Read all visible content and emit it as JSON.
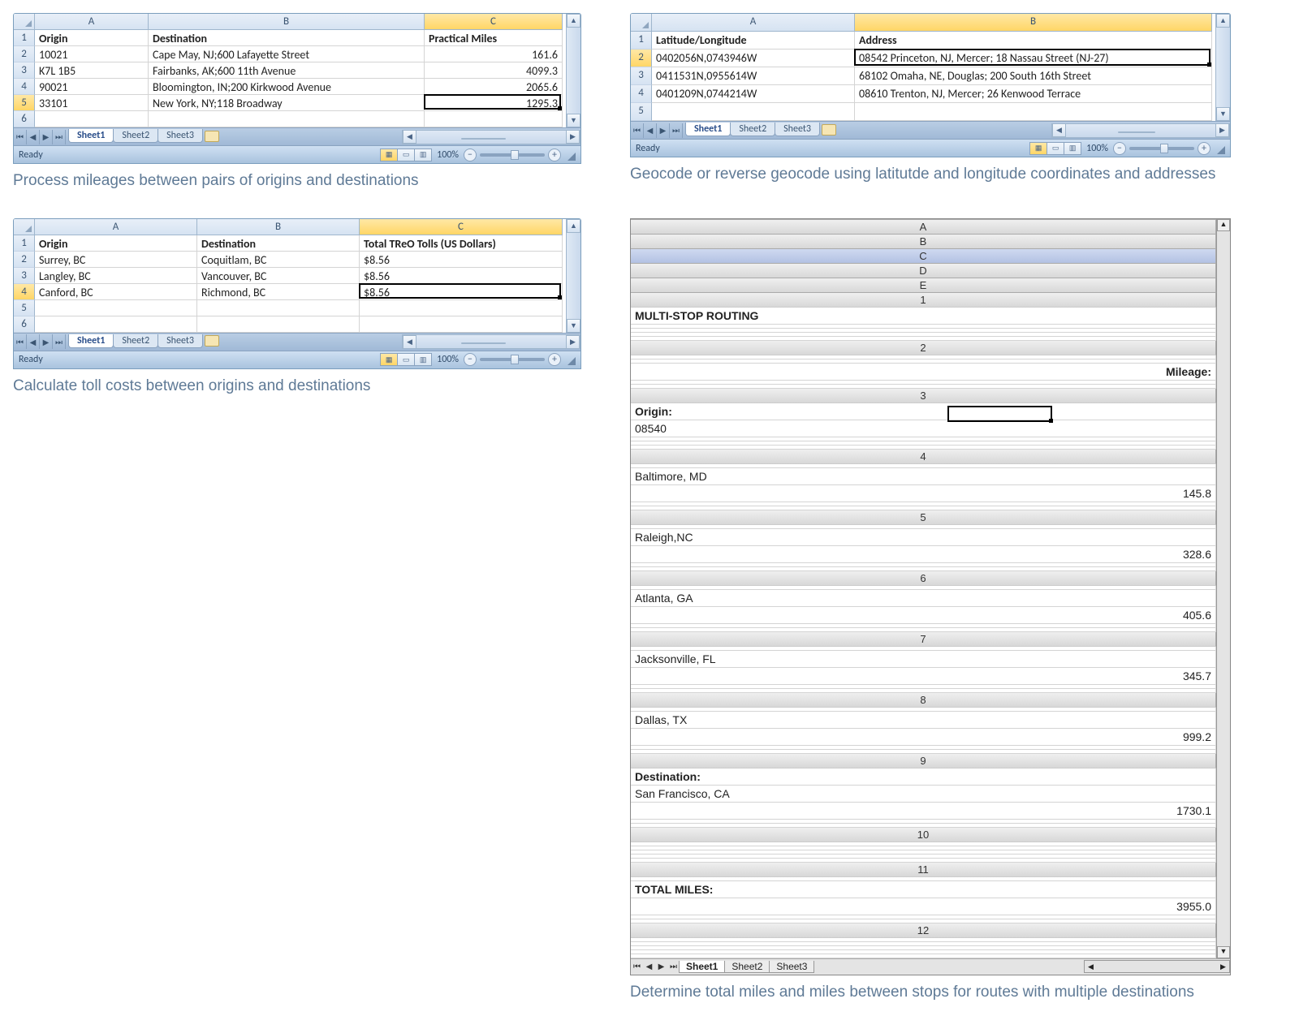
{
  "panes": {
    "p1": {
      "cols": [
        "A",
        "B",
        "C"
      ],
      "selected_col_index": 2,
      "selected_row_index": 4,
      "sel_cell_label": "C5",
      "rows": [
        {
          "n": "1",
          "cells": [
            "Origin",
            "Destination",
            "Practical Miles"
          ],
          "bold": true,
          "right2": false
        },
        {
          "n": "2",
          "cells": [
            "10021",
            "Cape May, NJ;600 Lafayette Street",
            "161.6"
          ],
          "right2": true
        },
        {
          "n": "3",
          "cells": [
            "K7L 1B5",
            "Fairbanks, AK;600 11th Avenue",
            "4099.3"
          ],
          "right2": true
        },
        {
          "n": "4",
          "cells": [
            "90021",
            "Bloomington, IN;200 Kirkwood Avenue",
            "2065.6"
          ],
          "right2": true
        },
        {
          "n": "5",
          "cells": [
            "33101",
            "New York, NY;118 Broadway",
            "1295.3"
          ],
          "right2": true
        },
        {
          "n": "6",
          "cells": [
            "",
            "",
            ""
          ],
          "right2": false
        }
      ],
      "tabs": [
        "Sheet1",
        "Sheet2",
        "Sheet3"
      ],
      "active_tab": 0,
      "status": "Ready",
      "zoom": "100%",
      "caption": "Process mileages between pairs of origins and destinations"
    },
    "p2": {
      "cols": [
        "A",
        "B"
      ],
      "selected_col_index": 1,
      "selected_row_index": 1,
      "sel_cell_label": "B2",
      "rows": [
        {
          "n": "1",
          "cells": [
            "Latitude/Longitude",
            "Address"
          ],
          "bold": true
        },
        {
          "n": "2",
          "cells": [
            "0402056N,0743946W",
            "08542 Princeton, NJ, Mercer; 18 Nassau Street  (NJ-27)"
          ]
        },
        {
          "n": "3",
          "cells": [
            "0411531N,0955614W",
            "68102 Omaha, NE, Douglas; 200 South 16th Street"
          ]
        },
        {
          "n": "4",
          "cells": [
            "0401209N,0744214W",
            "08610 Trenton, NJ, Mercer; 26 Kenwood Terrace"
          ]
        },
        {
          "n": "5",
          "cells": [
            "",
            ""
          ]
        }
      ],
      "tabs": [
        "Sheet1",
        "Sheet2",
        "Sheet3"
      ],
      "active_tab": 0,
      "status": "Ready",
      "zoom": "100%",
      "caption": "Geocode or reverse geocode using latitutde and longitude coordinates and addresses"
    },
    "p3": {
      "cols": [
        "A",
        "B",
        "C"
      ],
      "selected_col_index": 2,
      "selected_row_index": 3,
      "sel_cell_label": "C4",
      "rows": [
        {
          "n": "1",
          "cells": [
            "Origin",
            "Destination",
            "Total TReO Tolls (US Dollars)"
          ],
          "bold": true
        },
        {
          "n": "2",
          "cells": [
            "Surrey, BC",
            "Coquitlam, BC",
            "$8.56"
          ]
        },
        {
          "n": "3",
          "cells": [
            "Langley, BC",
            "Vancouver, BC",
            "$8.56"
          ]
        },
        {
          "n": "4",
          "cells": [
            "Canford, BC",
            "Richmond, BC",
            "$8.56"
          ]
        },
        {
          "n": "5",
          "cells": [
            "",
            "",
            ""
          ]
        },
        {
          "n": "6",
          "cells": [
            "",
            "",
            ""
          ]
        }
      ],
      "tabs": [
        "Sheet1",
        "Sheet2",
        "Sheet3"
      ],
      "active_tab": 0,
      "status": "Ready",
      "zoom": "100%",
      "caption": "Calculate toll costs between origins and destinations"
    },
    "p4": {
      "cols": [
        "A",
        "B",
        "C",
        "D",
        "E"
      ],
      "selected_col_index": 2,
      "sel_cell_label": "C11",
      "rows": [
        {
          "n": "1",
          "cells": [
            "MULTI-STOP ROUTING",
            "",
            "",
            "",
            ""
          ],
          "bold0": true
        },
        {
          "n": "2",
          "cells": [
            "",
            "",
            "Mileage:",
            "",
            ""
          ],
          "bold2": true,
          "right2": true
        },
        {
          "n": "3",
          "cells": [
            "Origin:",
            "08540",
            "",
            "",
            ""
          ],
          "bold0": true
        },
        {
          "n": "4",
          "cells": [
            "",
            "Baltimore, MD",
            "145.8",
            "",
            ""
          ],
          "right2": true
        },
        {
          "n": "5",
          "cells": [
            "",
            "Raleigh,NC",
            "328.6",
            "",
            ""
          ],
          "right2": true
        },
        {
          "n": "6",
          "cells": [
            "",
            "Atlanta, GA",
            "405.6",
            "",
            ""
          ],
          "right2": true
        },
        {
          "n": "7",
          "cells": [
            "",
            "Jacksonville, FL",
            "345.7",
            "",
            ""
          ],
          "right2": true
        },
        {
          "n": "8",
          "cells": [
            "",
            "Dallas, TX",
            "999.2",
            "",
            ""
          ],
          "right2": true
        },
        {
          "n": "9",
          "cells": [
            "Destination:",
            "San Francisco, CA",
            "1730.1",
            "",
            ""
          ],
          "bold0": true,
          "right2": true
        },
        {
          "n": "10",
          "cells": [
            "",
            "",
            "",
            "",
            ""
          ]
        },
        {
          "n": "11",
          "cells": [
            "",
            "TOTAL MILES:",
            "3955.0",
            "",
            ""
          ],
          "bold1": true,
          "right2": true
        },
        {
          "n": "12",
          "cells": [
            "",
            "",
            "",
            "",
            ""
          ]
        }
      ],
      "tabs": [
        "Sheet1",
        "Sheet2",
        "Sheet3"
      ],
      "active_tab": 0,
      "caption": "Determine total miles and miles between stops for routes with multiple destinations"
    }
  }
}
